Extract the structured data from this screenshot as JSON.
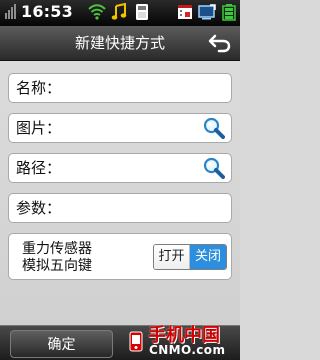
{
  "status_bar": {
    "time": "16:53",
    "icons": [
      "signal-icon",
      "wifi-icon",
      "music-icon",
      "sd-card-icon",
      "calendar-icon",
      "monitor-icon",
      "battery-icon"
    ]
  },
  "header": {
    "title": "新建快捷方式",
    "back_icon": "back-arrow-icon"
  },
  "fields": {
    "name": {
      "label": "名称："
    },
    "image": {
      "label": "图片：",
      "icon": "search-icon"
    },
    "path": {
      "label": "路径：",
      "icon": "search-icon"
    },
    "params": {
      "label": "参数："
    }
  },
  "gravity_sensor": {
    "line1": "重力传感器",
    "line2": "模拟五向键",
    "on_label": "打开",
    "off_label": "关闭",
    "selected": "关闭",
    "selected_color": "#2b8ede"
  },
  "bottom": {
    "confirm_label": "确定"
  },
  "watermark": {
    "line1": "手机中国",
    "line2": "CNMO.com"
  }
}
